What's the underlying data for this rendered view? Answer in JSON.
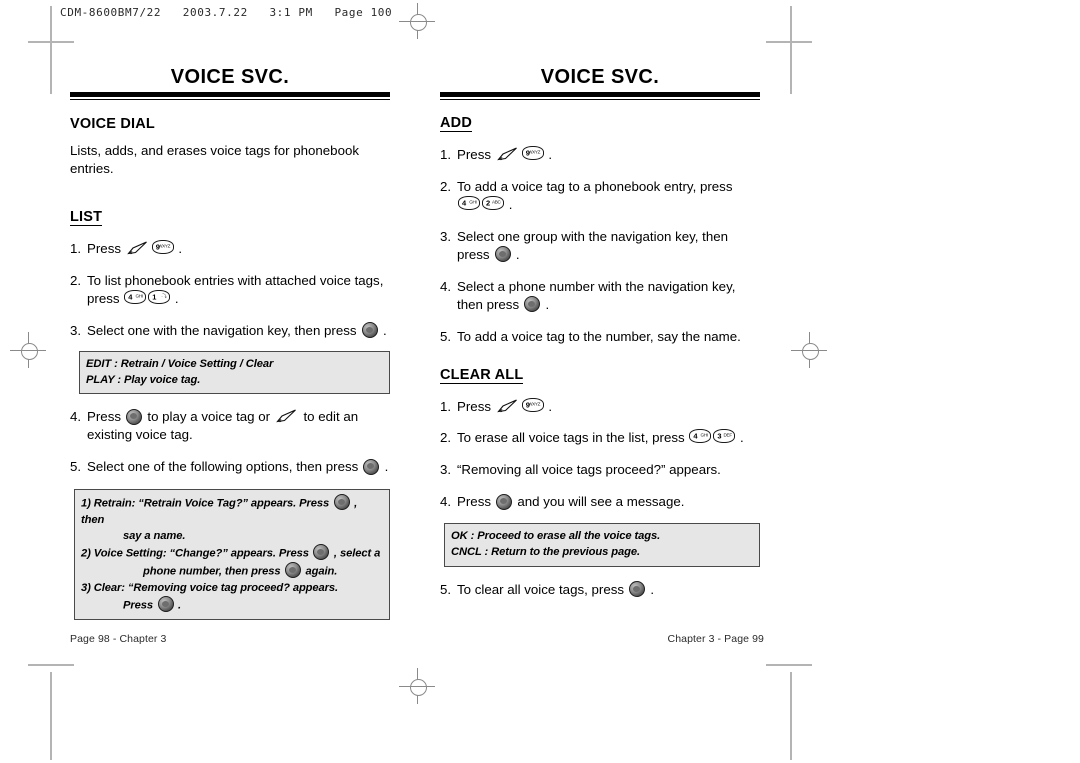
{
  "plate_header": "CDM-8600BM7/22   2003.7.22   3:1 PM   Page 100",
  "left_page": {
    "title": "VOICE SVC.",
    "heading": "VOICE DIAL",
    "intro": "Lists, adds, and erases voice tags for phonebook entries.",
    "subheading": "LIST",
    "steps": [
      {
        "num": "1.",
        "before": "Press ",
        "icons": [
          "pen-icon",
          "key-9"
        ],
        "after": " ."
      },
      {
        "num": "2.",
        "before": "To list phonebook entries with attached voice tags, press ",
        "icons": [
          "key-4",
          "key-1"
        ],
        "after": " ."
      },
      {
        "num": "3.",
        "before": "Select one with the navigation key, then press ",
        "icons": [
          "ok-button"
        ],
        "after": " ."
      },
      {
        "num": "4.",
        "before": "Press ",
        "icons": [
          "ok-button"
        ],
        "mid": " to play a voice tag or ",
        "icons2": [
          "pen-icon"
        ],
        "after": " to edit an existing voice tag."
      },
      {
        "num": "5.",
        "before": "Select one of the following options, then press ",
        "icons": [
          "ok-button"
        ],
        "after": " ."
      }
    ],
    "note_box_1": {
      "line1": "EDIT : Retrain / Voice Setting / Clear",
      "line2": "PLAY : Play voice tag."
    },
    "note_box_2": {
      "item1_a": "1) Retrain: “Retrain Voice Tag?” appears. Press ",
      "item1_b": " , then",
      "item1_c": "say a name.",
      "item2_a": "2) Voice Setting: “Change?” appears. Press ",
      "item2_b": " , select a",
      "item2_c": "phone number, then press ",
      "item2_d": " again.",
      "item3_a": "3) Clear: “Removing voice tag proceed? appears.",
      "item3_b": "Press ",
      "item3_c": " ."
    },
    "footer": "Page 98 - Chapter 3"
  },
  "right_page": {
    "title": "VOICE SVC.",
    "subheading_add": "ADD",
    "add_steps": [
      {
        "num": "1.",
        "before": "Press ",
        "after": " ."
      },
      {
        "num": "2.",
        "before": "To add a voice tag to a phonebook entry, press ",
        "after": " ."
      },
      {
        "num": "3.",
        "before": "Select one group with the navigation key, then press ",
        "after": " ."
      },
      {
        "num": "4.",
        "before": "Select a phone number with the navigation key, then press ",
        "after": " ."
      },
      {
        "num": "5.",
        "before": "To add a voice tag to the number, say the name.",
        "after": ""
      }
    ],
    "subheading_clear": "CLEAR ALL",
    "clear_steps": [
      {
        "num": "1.",
        "before": "Press ",
        "after": " ."
      },
      {
        "num": "2.",
        "before": "To erase all voice tags in the list, press ",
        "after": " ."
      },
      {
        "num": "3.",
        "before": "“Removing all voice tags proceed?” appears.",
        "after": ""
      },
      {
        "num": "4.",
        "before": "Press ",
        "after": " and you will see a message."
      },
      {
        "num": "5.",
        "before": "To clear all voice tags, press ",
        "after": " ."
      }
    ],
    "note_box": {
      "line1": "OK : Proceed to erase all the voice tags.",
      "line2": "CNCL : Return to the previous page."
    },
    "footer": "Chapter 3 - Page 99"
  },
  "keys": {
    "k1": {
      "num": "1",
      "sub": "·⤵"
    },
    "k2": {
      "num": "2",
      "sub": "ABC"
    },
    "k3": {
      "num": "3",
      "sub": "DEF"
    },
    "k4": {
      "num": "4",
      "sub": "GHI"
    },
    "k9": {
      "num": "9",
      "sub": "WXYZ"
    }
  },
  "colors": {
    "rule": "#000000",
    "note_bg": "#e6e6e6",
    "note_border": "#4a4a4a",
    "crop_mark": "#b4b4b4",
    "reg_mark": "#8a8a8a"
  }
}
